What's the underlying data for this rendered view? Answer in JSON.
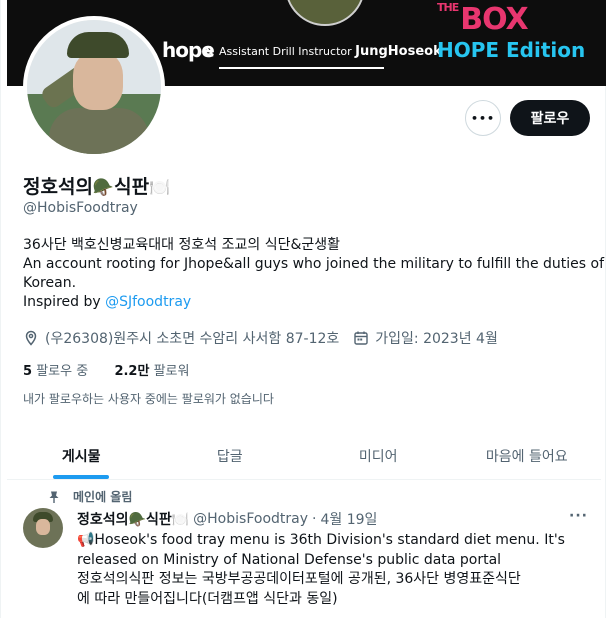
{
  "banner": {
    "hope_text": "hope",
    "amp": "&",
    "drill_prefix": "Assistant Drill Instructor",
    "drill_name": "JungHoseok",
    "the_box_small": "THE",
    "the_box_big": "BOX",
    "hope_edition": "HOPE Edition"
  },
  "actions": {
    "more_label": "•••",
    "follow_label": "팔로우"
  },
  "profile": {
    "name_text": "정호석의",
    "name_emoji_helmet": "🪖",
    "name_text2": "식판",
    "name_emoji_tray": "🍽️",
    "handle": "@HobisFoodtray",
    "bio_line1": "36사단 백호신병교육대대 정호석 조교의 식단&군생활",
    "bio_line2": "An account rooting for Jhope&all guys who joined the military to fulfill the duties of",
    "bio_line3": "Korean.",
    "bio_inspired": "Inspired by",
    "bio_link": "@SJfoodtray",
    "location": "(우26308)원주시 소초면 수암리 사서함 87-12호",
    "joined": "가입일: 2023년 4월",
    "following_count": "5",
    "following_label": "팔로우 중",
    "followers_count": "2.2만",
    "followers_label": "팔로워",
    "no_followers_you_know": "내가 팔로우하는 사용자 중에는 팔로워가 없습니다"
  },
  "tabs": [
    {
      "label": "게시물"
    },
    {
      "label": "답글"
    },
    {
      "label": "미디어"
    },
    {
      "label": "마음에 들어요"
    }
  ],
  "pinned_tweet": {
    "pinned_label": "메인에 올림",
    "author_name": "정호석의🪖식판🍽️",
    "author_handle": "@HobisFoodtray",
    "dot": "·",
    "date": "4월 19일",
    "more_label": "···",
    "line1": "📢Hoseok's food tray menu is 36th Division's standard diet menu. It's",
    "line2": "released on Ministry of National Defense's public data portal",
    "line3": "정호석의식판 정보는 국방부공공데이터포털에 공개된, 36사단 병영표준식단",
    "line4": "에 따라 만들어집니다(더캠프앱 식단과 동일)"
  },
  "colors": {
    "accent": "#1d9bf0",
    "text_primary": "#0f1419",
    "text_secondary": "#536471",
    "follow_button_bg": "#0f1419",
    "banner_bg": "#0d0d0d",
    "box_pink": "#e8366f",
    "hope_blue": "#27c5f0"
  }
}
